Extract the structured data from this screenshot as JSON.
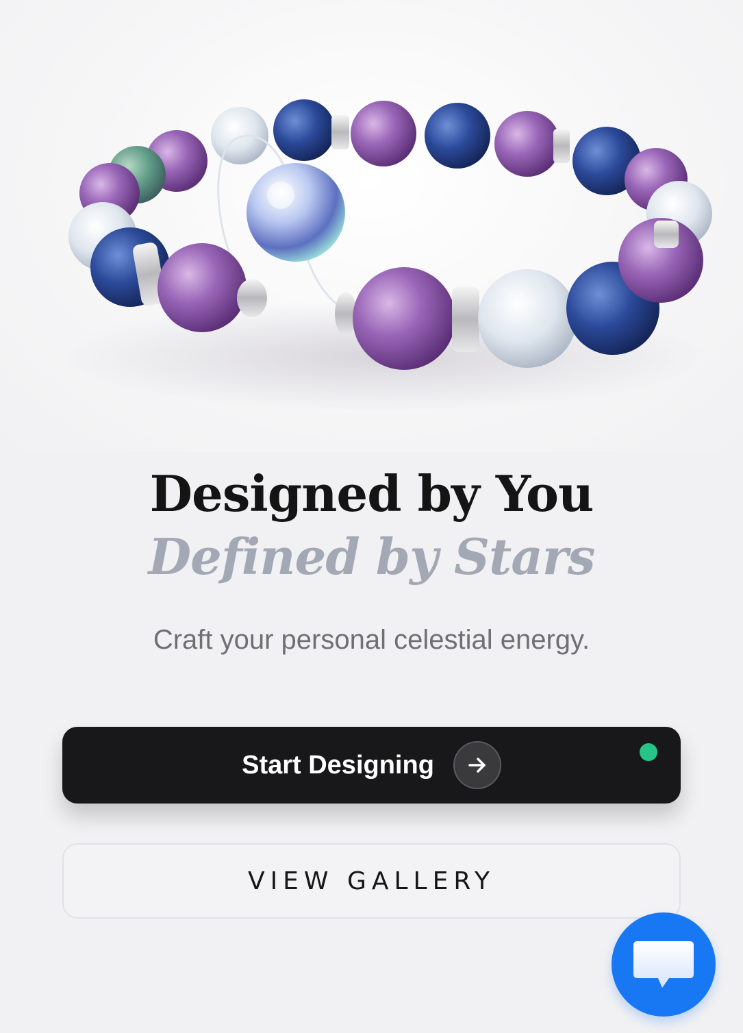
{
  "hero": {
    "image_alt": "bracelet-photo"
  },
  "headline": {
    "line1": "Designed by You",
    "line2": "Defined by Stars"
  },
  "subtitle": "Craft your personal celestial energy.",
  "primary_button": {
    "label": "Start Designing",
    "icon": "arrow-right-icon",
    "status_color": "#27c48a"
  },
  "secondary_button": {
    "label": "VIEW GALLERY"
  },
  "chat": {
    "icon": "chat-bubble-icon",
    "color": "#1877f2"
  }
}
